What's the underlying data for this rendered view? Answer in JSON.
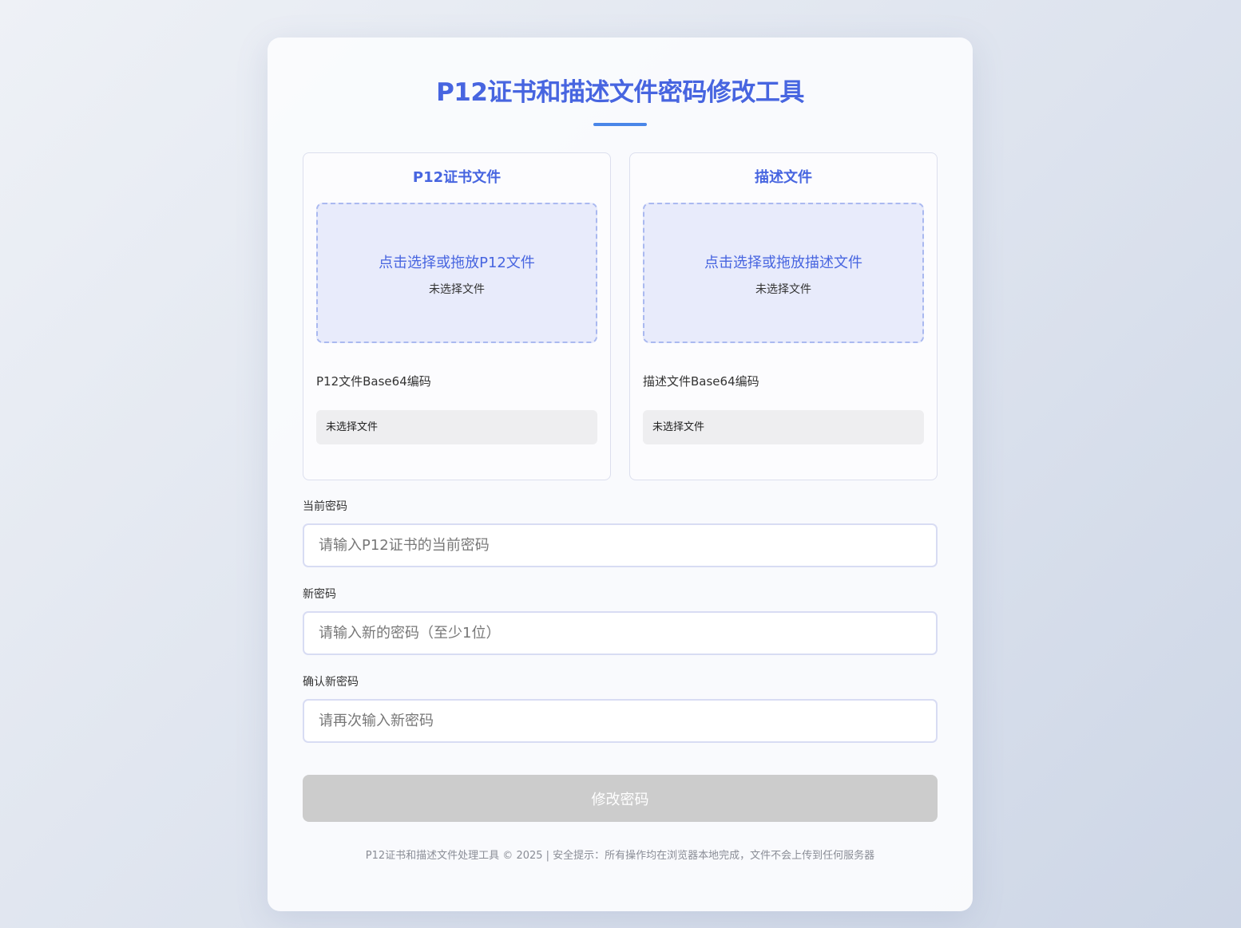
{
  "page": {
    "title": "P12证书和描述文件密码修改工具"
  },
  "panels": {
    "p12": {
      "title": "P12证书文件",
      "dropzone_prompt": "点击选择或拖放P12文件",
      "dropzone_status": "未选择文件",
      "base64_label": "P12文件Base64编码",
      "base64_value": "未选择文件"
    },
    "profile": {
      "title": "描述文件",
      "dropzone_prompt": "点击选择或拖放描述文件",
      "dropzone_status": "未选择文件",
      "base64_label": "描述文件Base64编码",
      "base64_value": "未选择文件"
    }
  },
  "form": {
    "current_password": {
      "label": "当前密码",
      "placeholder": "请输入P12证书的当前密码",
      "value": ""
    },
    "new_password": {
      "label": "新密码",
      "placeholder": "请输入新的密码（至少1位）",
      "value": ""
    },
    "confirm_password": {
      "label": "确认新密码",
      "placeholder": "请再次输入新密码",
      "value": ""
    },
    "submit_label": "修改密码"
  },
  "footer": {
    "text": "P12证书和描述文件处理工具 © 2025 | 安全提示：所有操作均在浏览器本地完成，文件不会上传到任何服务器"
  },
  "colors": {
    "accent": "#4765e0",
    "underline": "#4a86e8",
    "dropzone_bg": "#e8ebfb",
    "dropzone_border": "#aab9f0",
    "button_disabled": "#cccccc"
  }
}
